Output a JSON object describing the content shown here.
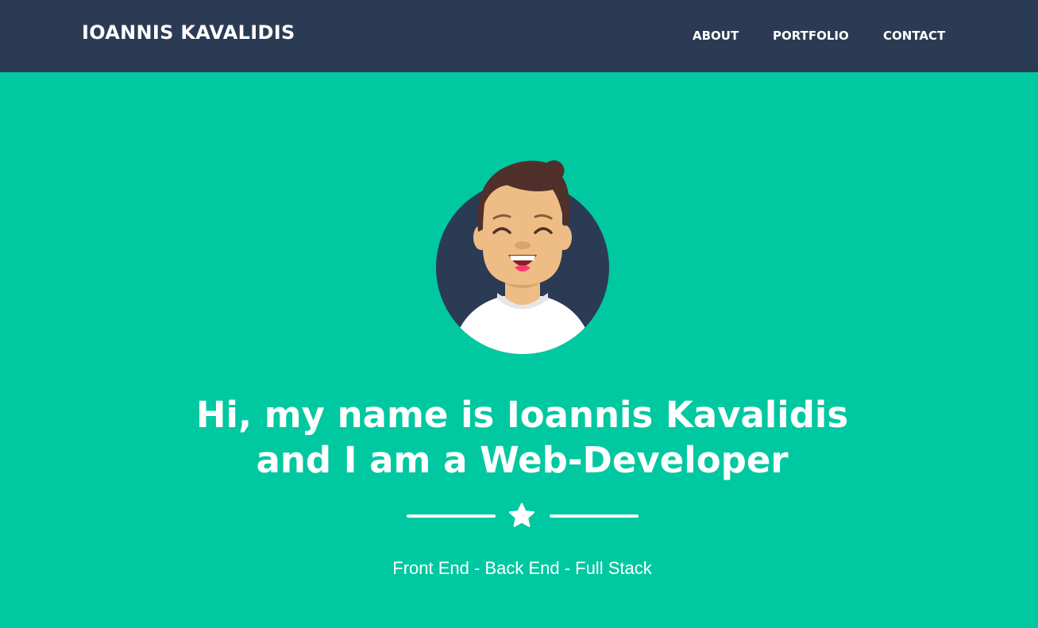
{
  "navbar": {
    "brand": "IOANNIS KAVALIDIS",
    "links": [
      {
        "label": "ABOUT"
      },
      {
        "label": "PORTFOLIO"
      },
      {
        "label": "CONTACT"
      }
    ]
  },
  "hero": {
    "avatar_icon": "developer-avatar-icon",
    "title_line1": "Hi, my name is Ioannis Kavalidis",
    "title_line2": "and I am a Web-Developer",
    "divider_icon": "star-icon",
    "subtitle": "Front End - Back End - Full Stack"
  },
  "colors": {
    "navbar_bg": "#2c3b54",
    "hero_bg": "#00c8a0",
    "text": "#ffffff"
  }
}
